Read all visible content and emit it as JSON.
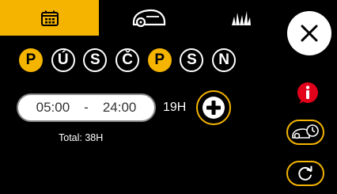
{
  "tabs": [
    {
      "icon": "calendar-icon",
      "active": true
    },
    {
      "icon": "mower-icon",
      "active": false
    },
    {
      "icon": "grass-icon",
      "active": false
    }
  ],
  "days": [
    {
      "label": "P",
      "active": true
    },
    {
      "label": "Ú",
      "active": false
    },
    {
      "label": "S",
      "active": false
    },
    {
      "label": "Č",
      "active": false
    },
    {
      "label": "P",
      "active": true
    },
    {
      "label": "S",
      "active": false
    },
    {
      "label": "N",
      "active": false
    }
  ],
  "schedule": {
    "start": "05:00",
    "separator": "-",
    "end": "24:00",
    "duration": "19H"
  },
  "total": "Total: 38H",
  "colors": {
    "accent": "#f5b400",
    "alert": "#e2001a"
  }
}
